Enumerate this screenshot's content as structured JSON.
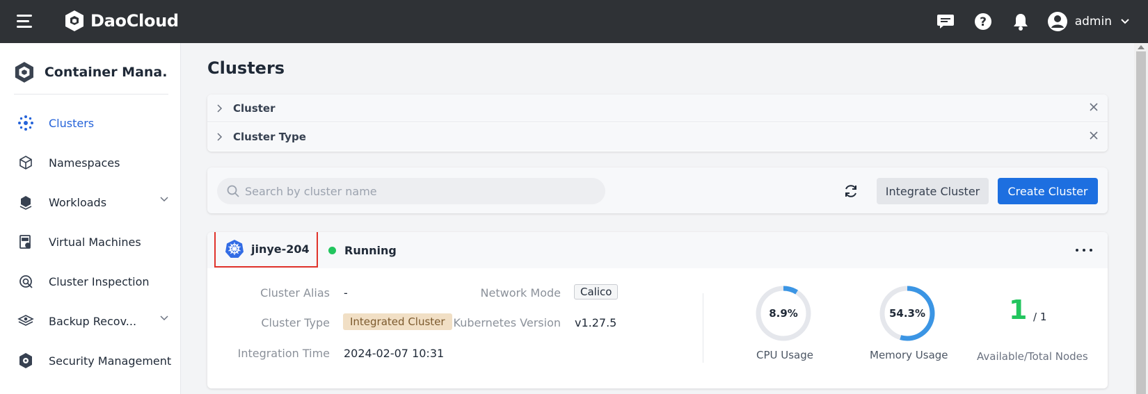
{
  "topbar": {
    "brand": "DaoCloud",
    "user": "admin",
    "icons": [
      "menu-icon",
      "message-icon",
      "help-icon",
      "bell-icon",
      "user-avatar-icon",
      "chevron-down-icon"
    ]
  },
  "sidebar": {
    "title": "Container Mana...",
    "items": [
      {
        "label": "Clusters",
        "icon": "clusters-icon",
        "active": true
      },
      {
        "label": "Namespaces",
        "icon": "namespace-icon"
      },
      {
        "label": "Workloads",
        "icon": "workloads-icon",
        "expandable": true
      },
      {
        "label": "Virtual Machines",
        "icon": "vm-icon"
      },
      {
        "label": "Cluster Inspection",
        "icon": "inspection-icon"
      },
      {
        "label": "Backup Recov...",
        "icon": "backup-icon",
        "expandable": true
      },
      {
        "label": "Security Management",
        "icon": "security-icon"
      }
    ]
  },
  "main": {
    "title": "Clusters",
    "filters": [
      "Cluster",
      "Cluster Type"
    ],
    "search_placeholder": "Search by cluster name",
    "integrate_label": "Integrate Cluster",
    "create_label": "Create Cluster"
  },
  "cluster": {
    "name": "jinye-204",
    "status": "Running",
    "alias_label": "Cluster Alias",
    "alias": "-",
    "type_label": "Cluster Type",
    "type": "Integrated Cluster",
    "time_label": "Integration Time",
    "time": "2024-02-07 10:31",
    "network_label": "Network Mode",
    "network": "Calico",
    "k8s_label": "Kubernetes Version",
    "k8s": "v1.27.5",
    "cpu_value": "8.9%",
    "cpu_fraction": 0.089,
    "cpu_label": "CPU Usage",
    "mem_value": "54.3%",
    "mem_fraction": 0.543,
    "mem_label": "Memory Usage",
    "nodes_available": "1",
    "nodes_total": "/ 1",
    "nodes_label": "Available/Total Nodes"
  },
  "colors": {
    "topbar": "#2f3236",
    "accent": "#1d6fe0",
    "running": "#22c55e",
    "gauge": "#3b95e4",
    "highlight": "#e0322a"
  }
}
